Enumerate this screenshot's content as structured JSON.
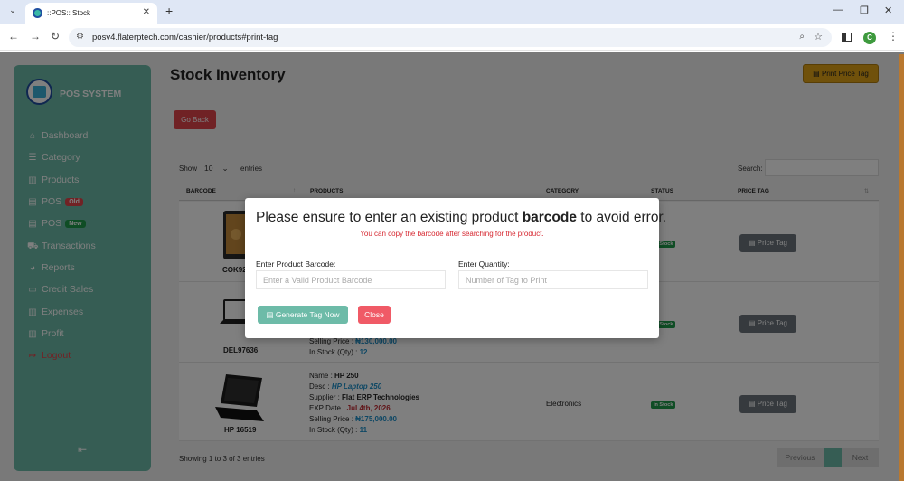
{
  "browser": {
    "tab_title": "::POS:: Stock",
    "url": "posv4.flaterptech.com/cashier/products#print-tag",
    "profile_initial": "C"
  },
  "sidebar": {
    "brand": "POS SYSTEM",
    "items": [
      {
        "label": "Dashboard",
        "icon": "home-icon"
      },
      {
        "label": "Category",
        "icon": "list-icon"
      },
      {
        "label": "Products",
        "icon": "chart-icon"
      },
      {
        "label": "POS",
        "icon": "printer-icon",
        "badge": "Old"
      },
      {
        "label": "POS",
        "icon": "printer-icon",
        "badge": "New"
      },
      {
        "label": "Transactions",
        "icon": "truck-icon"
      },
      {
        "label": "Reports",
        "icon": "pie-chart-icon"
      },
      {
        "label": "Credit Sales",
        "icon": "credit-card-icon"
      },
      {
        "label": "Expenses",
        "icon": "chart-icon"
      },
      {
        "label": "Profit",
        "icon": "chart-icon"
      },
      {
        "label": "Logout",
        "icon": "sign-out-icon"
      }
    ]
  },
  "page": {
    "title": "Stock Inventory",
    "print_button": "Print Price Tag",
    "go_back": "Go Back"
  },
  "table": {
    "show_label": "Show",
    "length": "10",
    "entries_label": "entries",
    "search_label": "Search:",
    "columns": [
      "BARCODE",
      "PRODUCTS",
      "CATEGORY",
      "STATUS",
      "PRICE TAG"
    ],
    "rows": [
      {
        "barcode": "COK92",
        "status": "In Stock",
        "price_tag": "Price Tag"
      },
      {
        "barcode": "DEL97636",
        "selling_price_label": "Selling Price :",
        "selling_price": "₦130,000.00",
        "stock_label": "In Stock (Qty) :",
        "stock": "12",
        "status": "In Stock",
        "price_tag": "Price Tag"
      },
      {
        "barcode": "HP 16519",
        "name_label": "Name :",
        "name": "HP 250",
        "desc_label": "Desc :",
        "desc": "HP Laptop 250",
        "supplier_label": "Supplier :",
        "supplier": "Flat ERP Technologies",
        "exp_label": "EXP Date :",
        "exp": "Jul 4th, 2026",
        "selling_price_label": "Selling Price :",
        "selling_price": "₦175,000.00",
        "stock_label": "In Stock (Qty) :",
        "stock": "11",
        "category": "Electronics",
        "status": "In Stock",
        "price_tag": "Price Tag"
      }
    ],
    "showing_info": "Showing 1 to 3 of 3 entries",
    "pagination": {
      "previous": "Previous",
      "current": "",
      "next": "Next"
    }
  },
  "modal": {
    "title_pre": "Please ensure to enter an existing product ",
    "title_bold": "barcode",
    "title_post": " to avoid error.",
    "subtitle": "You can copy the barcode after searching for the product.",
    "barcode_label": "Enter Product Barcode:",
    "barcode_placeholder": "Enter a Valid Product Barcode",
    "quantity_label": "Enter Quantity:",
    "quantity_placeholder": "Number of Tag to Print",
    "generate_button": "Generate Tag Now",
    "close_button": "Close"
  },
  "colors": {
    "sidebar": "#6dbba8",
    "print_button": "#e0a216",
    "danger": "#e0444b",
    "status_green": "#1f9a4b",
    "link_blue": "#1a8ec9"
  }
}
